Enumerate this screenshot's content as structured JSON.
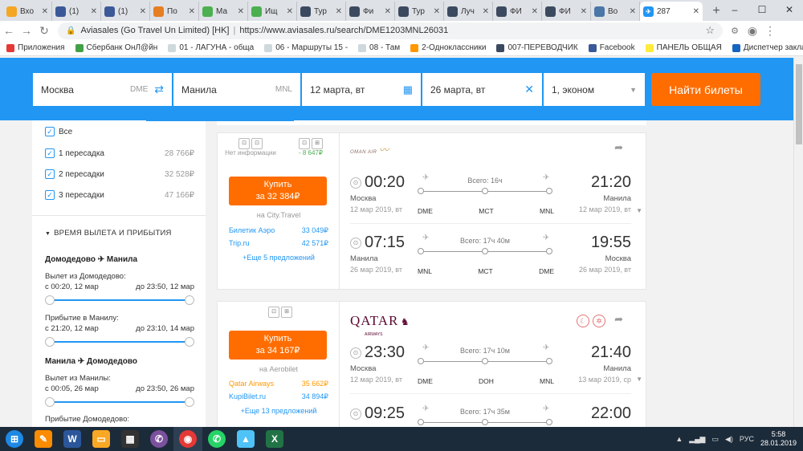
{
  "browser": {
    "tabs": [
      {
        "label": "Вхо",
        "favicon": "mail-icon",
        "color": "#f5a623"
      },
      {
        "label": "(1)",
        "favicon": "facebook-icon",
        "color": "#3b5998"
      },
      {
        "label": "(1)",
        "favicon": "facebook-icon",
        "color": "#3b5998"
      },
      {
        "label": "По",
        "favicon": "flight-icon",
        "color": "#e67e22"
      },
      {
        "label": "Ма",
        "favicon": "map-icon",
        "color": "#4caf50"
      },
      {
        "label": "Ищ",
        "favicon": "map-icon",
        "color": "#4caf50"
      },
      {
        "label": "Тур",
        "favicon": "globe-icon",
        "color": "#3c4a60"
      },
      {
        "label": "Фи",
        "favicon": "globe-icon",
        "color": "#3c4a60"
      },
      {
        "label": "Тур",
        "favicon": "globe-icon",
        "color": "#3c4a60"
      },
      {
        "label": "Луч",
        "favicon": "globe-icon",
        "color": "#3c4a60"
      },
      {
        "label": "ФИ",
        "favicon": "globe-icon",
        "color": "#3c4a60"
      },
      {
        "label": "ФИ",
        "favicon": "globe-icon",
        "color": "#3c4a60"
      },
      {
        "label": "Во",
        "favicon": "vk-icon",
        "color": "#4a76a8"
      }
    ],
    "active_tab": {
      "label": "287",
      "favicon": "aviasales-icon",
      "color": "#2196f3"
    },
    "site_name": "Aviasales (Go Travel Un Limited) [HK]",
    "url_sep": "|",
    "url": "https://www.aviasales.ru/search/DME1203MNL26031",
    "bookmarks": [
      {
        "label": "Приложения",
        "color": "#e53935"
      },
      {
        "label": "Сбербанк ОнЛ@йн",
        "color": "#43a047"
      },
      {
        "label": "01 - ЛАГУНА - обща",
        "color": "#cfd8dc"
      },
      {
        "label": "06 - Маршруты 15 -",
        "color": "#cfd8dc"
      },
      {
        "label": "08 - Там",
        "color": "#cfd8dc"
      },
      {
        "label": "2-Одноклассники",
        "color": "#ff9800"
      },
      {
        "label": "007-ПЕРЕВОДЧИК",
        "color": "#3c4a60"
      },
      {
        "label": "Facebook",
        "color": "#3b5998"
      },
      {
        "label": "ПАНЕЛЬ ОБЩАЯ",
        "color": "#ffeb3b"
      },
      {
        "label": "Диспетчер закладок",
        "color": "#1565c0"
      }
    ]
  },
  "search": {
    "origin": "Москва",
    "origin_code": "DME",
    "destination": "Манила",
    "destination_code": "MNL",
    "depart_date": "12 марта, вт",
    "return_date": "26 марта, вт",
    "passengers": "1, эконом",
    "button": "Найти билеты"
  },
  "filters": {
    "stops": [
      {
        "label": "Все",
        "price": ""
      },
      {
        "label": "1 пересадка",
        "price": "28 766₽"
      },
      {
        "label": "2 пересадки",
        "price": "32 528₽"
      },
      {
        "label": "3 пересадки",
        "price": "47 166₽"
      }
    ],
    "times_header": "ВРЕМЯ ВЫЛЕТА И ПРИБЫТИЯ",
    "route1": "Домодедово ✈ Манила",
    "route1_dep_label": "Вылет из Домодедово:",
    "route1_dep_from": "с 00:20, 12 мар",
    "route1_dep_to": "до 23:50, 12 мар",
    "route1_arr_label": "Прибытие в Манилу:",
    "route1_arr_from": "с 21:20, 12 мар",
    "route1_arr_to": "до 23:10, 14 мар",
    "route2": "Манила ✈ Домодедово",
    "route2_dep_label": "Вылет из Манилы:",
    "route2_dep_from": "с 00:05, 26 мар",
    "route2_dep_to": "до 23:50, 26 мар",
    "route2_arr_label": "Прибытие Домодедово:"
  },
  "tickets": [
    {
      "bag_left": "Нет информации",
      "bag_right": "- 8 647₽",
      "buy_label": "Купить",
      "price": "за 32 384₽",
      "seller": "на City.Travel",
      "alternatives": [
        {
          "name": "Билетик Аэро",
          "price": "33 049₽"
        },
        {
          "name": "Trip.ru",
          "price": "42 571₽"
        }
      ],
      "more": "+Еще 5 предложений",
      "airline": "OMAN AIR",
      "segments": [
        {
          "dep_time": "00:20",
          "arr_time": "21:20",
          "duration": "Всего: 16ч",
          "dep_city": "Москва",
          "arr_city": "Манила",
          "dep_date": "12 мар 2019, вт",
          "arr_date": "12 мар 2019, вт",
          "codes": [
            "DME",
            "MCT",
            "MNL"
          ]
        },
        {
          "dep_time": "07:15",
          "arr_time": "19:55",
          "duration": "Всего: 17ч 40м",
          "dep_city": "Манила",
          "arr_city": "Москва",
          "dep_date": "26 мар 2019, вт",
          "arr_date": "26 мар 2019, вт",
          "codes": [
            "MNL",
            "MCT",
            "DME"
          ]
        }
      ]
    },
    {
      "bag_left": "",
      "bag_right": "",
      "buy_label": "Купить",
      "price": "за 34 167₽",
      "seller": "на Aerobilet",
      "alternatives": [
        {
          "name": "Qatar Airways",
          "price": "35 662₽"
        },
        {
          "name": "KupiBilet.ru",
          "price": "34 894₽"
        }
      ],
      "more": "+Еще 13 предложений",
      "airline": "QATAR",
      "airline_sub": "AIRWAYS",
      "segments": [
        {
          "dep_time": "23:30",
          "arr_time": "21:40",
          "duration": "Всего: 17ч 10м",
          "dep_city": "Москва",
          "arr_city": "Манила",
          "dep_date": "12 мар 2019, вт",
          "arr_date": "13 мар 2019, ср",
          "codes": [
            "DME",
            "DOH",
            "MNL"
          ]
        },
        {
          "dep_time": "09:25",
          "arr_time": "22:00",
          "duration": "Всего: 17ч 35м",
          "dep_city": "",
          "arr_city": "",
          "dep_date": "",
          "arr_date": "",
          "codes": [
            "",
            "",
            ""
          ]
        }
      ]
    }
  ],
  "taskbar": {
    "lang": "РУС",
    "time": "5:58",
    "date": "28.01.2019"
  }
}
